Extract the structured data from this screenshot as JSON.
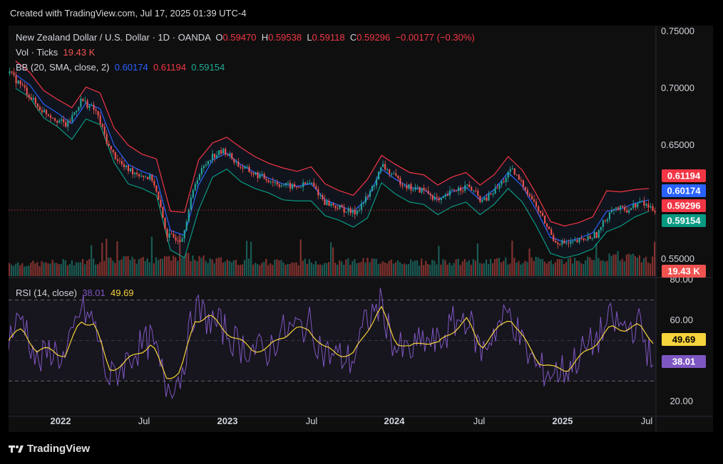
{
  "header": {
    "created": "Created with TradingView.com, Jul 17, 2025 01:39 UTC-4"
  },
  "legend": {
    "symbol": "New Zealand Dollar / U.S. Dollar · 1D · OANDA",
    "o_label": "O",
    "o_value": "0.59470",
    "h_label": "H",
    "h_value": "0.59538",
    "l_label": "L",
    "l_value": "0.59118",
    "c_label": "C",
    "c_value": "0.59296",
    "change": "−0.00177 (−0.30%)",
    "vol_label": "Vol · Ticks",
    "vol_value": "19.43 K",
    "bb_label": "BB (20, SMA, close, 2)",
    "bb_basis": "0.60174",
    "bb_upper": "0.61194",
    "bb_lower": "0.59154",
    "rsi_label": "RSI (14, close)",
    "rsi_value": "38.01",
    "rsi_ma": "49.69"
  },
  "price_axis": [
    "0.75000",
    "0.70000",
    "0.65000",
    "0.55000"
  ],
  "rsi_axis": [
    "80.00",
    "60.00",
    "20.00"
  ],
  "time_axis": [
    "2022",
    "Jul",
    "2023",
    "Jul",
    "2024",
    "Jul",
    "2025",
    "Jul"
  ],
  "badges": {
    "bb_upper": "0.61194",
    "bb_basis": "0.60174",
    "last_price": "0.59296",
    "bb_lower": "0.59154",
    "volume": "19.43 K",
    "rsi_ma": "49.69",
    "rsi": "38.01"
  },
  "footer": {
    "brand": "TradingView"
  },
  "colors": {
    "up": "#26a69a",
    "down": "#ef5350",
    "bb_upper": "#f23645",
    "bb_basis": "#2962ff",
    "bb_lower": "#089981",
    "rsi": "#7e57c2",
    "rsi_ma": "#f5d33b",
    "panel": "#0f0f0f"
  },
  "chart_data": {
    "type": "line",
    "instrument": "NZDUSD",
    "timeframe": "1D",
    "y_range": [
      0.535,
      0.755
    ],
    "rsi_range": [
      14,
      80
    ],
    "rsi_bands": [
      70,
      30
    ],
    "x": [
      "2021-10",
      "2021-11",
      "2021-12",
      "2022-01",
      "2022-02",
      "2022-03",
      "2022-04",
      "2022-05",
      "2022-06",
      "2022-07",
      "2022-08",
      "2022-09",
      "2022-10",
      "2022-11",
      "2022-12",
      "2023-01",
      "2023-02",
      "2023-03",
      "2023-04",
      "2023-05",
      "2023-06",
      "2023-07",
      "2023-08",
      "2023-09",
      "2023-10",
      "2023-11",
      "2023-12",
      "2024-01",
      "2024-02",
      "2024-03",
      "2024-04",
      "2024-05",
      "2024-06",
      "2024-07",
      "2024-08",
      "2024-09",
      "2024-10",
      "2024-11",
      "2024-12",
      "2025-01",
      "2025-02",
      "2025-03",
      "2025-04",
      "2025-05",
      "2025-06",
      "2025-07"
    ],
    "series": [
      {
        "name": "",
        "values": [
          0.713,
          0.7,
          0.683,
          0.675,
          0.667,
          0.69,
          0.68,
          0.646,
          0.63,
          0.625,
          0.62,
          0.57,
          0.568,
          0.62,
          0.64,
          0.645,
          0.632,
          0.625,
          0.62,
          0.615,
          0.613,
          0.617,
          0.6,
          0.595,
          0.59,
          0.605,
          0.632,
          0.62,
          0.612,
          0.61,
          0.6,
          0.611,
          0.614,
          0.6,
          0.612,
          0.628,
          0.612,
          0.59,
          0.566,
          0.563,
          0.567,
          0.572,
          0.595,
          0.593,
          0.6,
          0.593
        ]
      },
      {
        "name": "BB (20, SMA, close, 2)",
        "values": [
          0.712,
          0.703,
          0.686,
          0.678,
          0.669,
          0.687,
          0.682,
          0.65,
          0.633,
          0.627,
          0.622,
          0.575,
          0.571,
          0.615,
          0.637,
          0.643,
          0.633,
          0.626,
          0.621,
          0.616,
          0.614,
          0.616,
          0.602,
          0.597,
          0.592,
          0.603,
          0.629,
          0.62,
          0.613,
          0.611,
          0.602,
          0.609,
          0.613,
          0.602,
          0.611,
          0.626,
          0.614,
          0.593,
          0.569,
          0.565,
          0.568,
          0.573,
          0.592,
          0.594,
          0.599,
          0.602
        ]
      },
      {
        "name": "",
        "values": [
          0.724,
          0.714,
          0.698,
          0.69,
          0.683,
          0.701,
          0.696,
          0.665,
          0.65,
          0.642,
          0.638,
          0.592,
          0.591,
          0.637,
          0.652,
          0.657,
          0.648,
          0.64,
          0.634,
          0.63,
          0.627,
          0.631,
          0.616,
          0.61,
          0.606,
          0.62,
          0.641,
          0.633,
          0.626,
          0.624,
          0.615,
          0.622,
          0.626,
          0.615,
          0.624,
          0.64,
          0.628,
          0.607,
          0.583,
          0.579,
          0.582,
          0.587,
          0.61,
          0.609,
          0.611,
          0.612
        ]
      },
      {
        "name": "",
        "values": [
          0.7,
          0.692,
          0.674,
          0.666,
          0.655,
          0.673,
          0.668,
          0.635,
          0.616,
          0.612,
          0.606,
          0.558,
          0.551,
          0.593,
          0.622,
          0.629,
          0.618,
          0.612,
          0.608,
          0.602,
          0.601,
          0.601,
          0.588,
          0.584,
          0.578,
          0.586,
          0.617,
          0.607,
          0.6,
          0.598,
          0.589,
          0.596,
          0.6,
          0.589,
          0.598,
          0.612,
          0.6,
          0.579,
          0.555,
          0.551,
          0.554,
          0.559,
          0.574,
          0.579,
          0.587,
          0.592
        ]
      },
      {
        "name": "Vol · Ticks",
        "values": [
          16,
          15,
          15,
          16,
          17,
          17,
          18,
          20,
          20,
          19,
          20,
          24,
          24,
          22,
          19,
          19,
          18,
          18,
          17,
          17,
          17,
          17,
          18,
          18,
          18,
          18,
          19,
          18,
          17,
          17,
          17,
          17,
          17,
          17,
          19,
          18,
          18,
          19,
          19,
          19,
          19,
          20,
          26,
          23,
          21,
          19
        ]
      },
      {
        "name": "RSI (14, close)",
        "values": [
          52,
          62,
          38,
          46,
          40,
          66,
          58,
          30,
          38,
          46,
          50,
          28,
          32,
          66,
          60,
          56,
          48,
          46,
          44,
          54,
          56,
          58,
          44,
          42,
          40,
          60,
          68,
          46,
          44,
          50,
          48,
          58,
          62,
          44,
          56,
          64,
          46,
          36,
          34,
          36,
          44,
          50,
          60,
          56,
          58,
          38
        ]
      },
      {
        "name": "",
        "values": [
          50,
          56,
          44,
          46,
          42,
          60,
          58,
          36,
          38,
          44,
          48,
          32,
          34,
          60,
          62,
          56,
          50,
          46,
          45,
          52,
          55,
          56,
          46,
          44,
          42,
          55,
          66,
          50,
          46,
          50,
          48,
          55,
          60,
          47,
          54,
          62,
          50,
          40,
          36,
          36,
          42,
          49,
          56,
          56,
          57,
          50
        ]
      }
    ]
  }
}
